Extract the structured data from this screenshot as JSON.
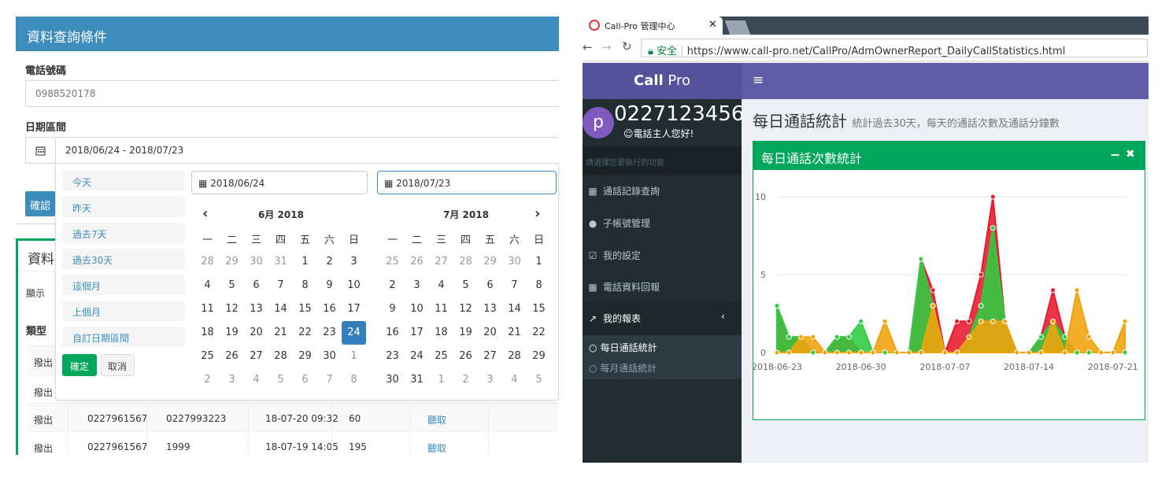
{
  "left": {
    "query_title": "資料查詢條件",
    "phone_label": "電話號碼",
    "phone_value": "0988520178",
    "date_label": "日期區間",
    "date_value": "2018/06/24 - 2018/07/23",
    "confirm_partial": "確認",
    "result_title_partial": "資料",
    "show_partial": "顯示",
    "type_header_partial": "類型",
    "rows": [
      {
        "type": "撥出",
        "from": "",
        "to": "",
        "time": "",
        "dur": "",
        "action": ""
      },
      {
        "type": "撥出",
        "from": "",
        "to": "",
        "time": "",
        "dur": "",
        "action": ""
      },
      {
        "type": "撥出",
        "from": "0227961567",
        "to": "0227993223",
        "time": "18-07-20 09:32",
        "dur": "60",
        "action": "聽取"
      },
      {
        "type": "撥出",
        "from": "0227961567",
        "to": "1999",
        "time": "18-07-19 14:05",
        "dur": "195",
        "action": "聽取"
      }
    ],
    "picker": {
      "ranges": [
        "今天",
        "昨天",
        "過去7天",
        "過去30天",
        "這個月",
        "上個月",
        "自訂日期區間"
      ],
      "apply": "確定",
      "cancel": "取消",
      "start_input": "2018/06/24",
      "end_input": "2018/07/23",
      "weekdays": [
        "一",
        "二",
        "三",
        "四",
        "五",
        "六",
        "日"
      ],
      "left_month": "6月 2018",
      "right_month": "7月 2018",
      "left_days": [
        [
          "28",
          "29",
          "30",
          "31",
          "1",
          "2",
          "3"
        ],
        [
          "4",
          "5",
          "6",
          "7",
          "8",
          "9",
          "10"
        ],
        [
          "11",
          "12",
          "13",
          "14",
          "15",
          "16",
          "17"
        ],
        [
          "18",
          "19",
          "20",
          "21",
          "22",
          "23",
          "24"
        ],
        [
          "25",
          "26",
          "27",
          "28",
          "29",
          "30",
          "1"
        ],
        [
          "2",
          "3",
          "4",
          "5",
          "6",
          "7",
          "8"
        ]
      ],
      "right_days": [
        [
          "25",
          "26",
          "27",
          "28",
          "29",
          "30",
          "1"
        ],
        [
          "2",
          "3",
          "4",
          "5",
          "6",
          "7",
          "8"
        ],
        [
          "9",
          "10",
          "11",
          "12",
          "13",
          "14",
          "15"
        ],
        [
          "16",
          "17",
          "18",
          "19",
          "20",
          "21",
          "22"
        ],
        [
          "23",
          "24",
          "25",
          "26",
          "27",
          "28",
          "29"
        ],
        [
          "30",
          "31",
          "1",
          "2",
          "3",
          "4",
          "5"
        ]
      ]
    }
  },
  "right": {
    "tab_title": "Call-Pro 管理中心",
    "secure_label": "安全",
    "url": "https://www.call-pro.net/CallPro/AdmOwnerReport_DailyCallStatistics.html",
    "logo_bold": "Call",
    "logo_light": " Pro",
    "avatar_letter": "p",
    "user_number": "0227123456",
    "greeting": "☺電話主人您好!",
    "menu_hint": "請選擇您要執行的功能",
    "menu": [
      "通話記錄查詢",
      "子帳號管理",
      "我的設定",
      "電話資料回報",
      "我的報表"
    ],
    "submenu": [
      "每日通話統計",
      "每月通話統計"
    ],
    "page_title": "每日通話統計",
    "page_subtitle": "統計過去30天，每天的通話次數及通話分鐘數",
    "box_title": "每日通話次數統計",
    "colors": {
      "red": "#e8192c",
      "green": "#2ecc40",
      "orange": "#f0a30a",
      "purple": "#605ca8"
    }
  },
  "chart_data": {
    "type": "area",
    "x": [
      "2018-06-23",
      "2018-06-24",
      "2018-06-25",
      "2018-06-26",
      "2018-06-27",
      "2018-06-28",
      "2018-06-29",
      "2018-06-30",
      "2018-07-01",
      "2018-07-02",
      "2018-07-03",
      "2018-07-04",
      "2018-07-05",
      "2018-07-06",
      "2018-07-07",
      "2018-07-08",
      "2018-07-09",
      "2018-07-10",
      "2018-07-11",
      "2018-07-12",
      "2018-07-13",
      "2018-07-14",
      "2018-07-15",
      "2018-07-16",
      "2018-07-17",
      "2018-07-18",
      "2018-07-19",
      "2018-07-20",
      "2018-07-21",
      "2018-07-22"
    ],
    "xticks": [
      "2018-06-23",
      "2018-06-30",
      "2018-07-07",
      "2018-07-14",
      "2018-07-21"
    ],
    "yticks": [
      0,
      5,
      10
    ],
    "ylim": [
      0,
      10
    ],
    "series": [
      {
        "color": "#e8192c",
        "values": [
          3,
          1,
          1,
          0,
          0,
          1,
          1,
          0,
          0,
          0,
          0,
          0,
          6,
          4,
          0,
          2,
          2,
          5,
          10,
          2,
          0,
          0,
          1,
          4,
          1,
          0,
          0,
          0,
          0,
          0
        ]
      },
      {
        "color": "#2ecc40",
        "values": [
          3,
          1,
          1,
          0,
          0,
          1,
          1,
          2,
          0,
          0,
          0,
          0,
          6,
          3,
          0,
          0,
          1,
          3,
          8,
          2,
          0,
          0,
          1,
          2,
          1,
          0,
          0,
          0,
          0,
          0
        ]
      },
      {
        "color": "#f0a30a",
        "values": [
          0,
          0,
          1,
          1,
          0,
          0,
          0,
          0,
          0,
          2,
          0,
          0,
          0,
          3,
          0,
          0,
          1,
          2,
          2,
          2,
          0,
          0,
          0,
          2,
          0,
          4,
          1,
          0,
          0,
          2
        ]
      }
    ]
  }
}
